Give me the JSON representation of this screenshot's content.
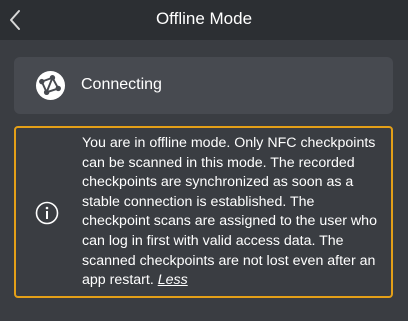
{
  "header": {
    "title": "Offline Mode"
  },
  "status": {
    "label": "Connecting",
    "icon": "network-globe-icon"
  },
  "info": {
    "icon": "info-icon",
    "accent_color": "#e4a018",
    "message": "You are in offline mode. Only NFC checkpoints can be scanned in this mode. The recorded checkpoints are synchronized as soon as a stable connection is established. The checkpoint scans are assigned to the user who can log in first with valid access data. The scanned checkpoints are not lost even after an app restart.",
    "less_label": "Less"
  }
}
